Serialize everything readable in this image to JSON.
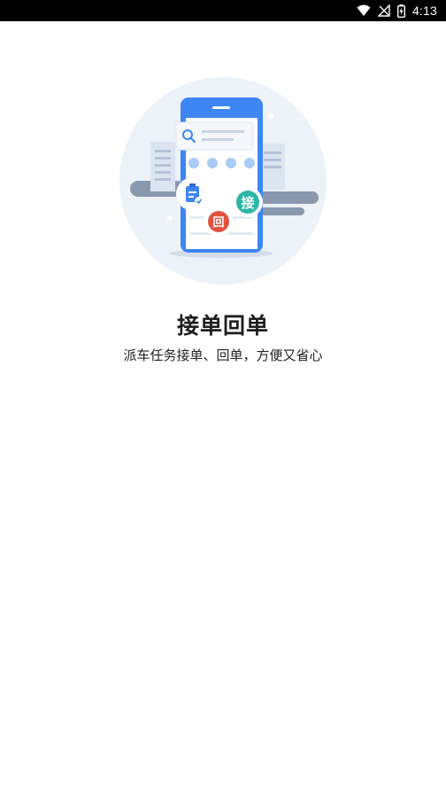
{
  "status_bar": {
    "time": "4:13",
    "icons": [
      "wifi-icon",
      "no-signal-icon",
      "battery-charging-icon"
    ]
  },
  "onboarding": {
    "title": "接单回单",
    "subtitle": "派车任务接单、回单，方便又省心",
    "badge_accept": "接",
    "badge_return": "回"
  },
  "colors": {
    "phone_blue": "#3D86F4",
    "badge_accept": "#2DB5A8",
    "badge_return": "#E2533F",
    "circle_bg": "#EDF1F8",
    "road_gray": "#8A98AE"
  }
}
